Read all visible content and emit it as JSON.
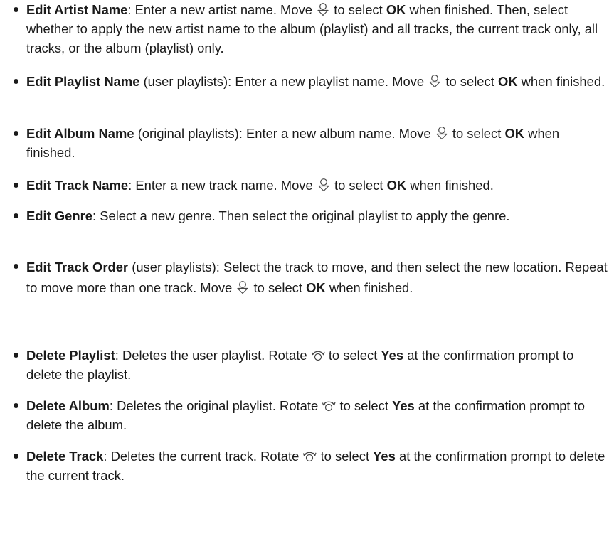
{
  "items": [
    {
      "term": "Edit Artist Name",
      "qualifier": "",
      "p1": ": Enter a new artist name. Move ",
      "icon1": "joystick-down-icon",
      "p2": " to select ",
      "kw1": "OK",
      "p3": " when finished. Then, select whether to apply the new artist name to the album (playlist) and all tracks, the current track only, all tracks, or the album (playlist) only."
    },
    {
      "term": "Edit Playlist Name",
      "qualifier": " (user playlists)",
      "p1": ": Enter a new playlist name. Move ",
      "icon1": "joystick-down-icon",
      "p2": " to select ",
      "kw1": "OK",
      "p3": " when finished."
    },
    {
      "term": "Edit Album Name",
      "qualifier": " (original playlists)",
      "p1": ": Enter a new album name. Move ",
      "icon1": "joystick-down-icon",
      "p2": " to select ",
      "kw1": "OK",
      "p3": " when finished."
    },
    {
      "term": "Edit Track Name",
      "qualifier": "",
      "p1": ": Enter a new track name. Move ",
      "icon1": "joystick-down-icon",
      "p2": " to select ",
      "kw1": "OK",
      "p3": " when finished."
    },
    {
      "term": "Edit Genre",
      "qualifier": "",
      "p1": ": Select a new genre. Then select the original playlist to apply the genre."
    },
    {
      "term": "Edit Track Order",
      "qualifier": " (user playlists)",
      "p1": ": Select the track to move, and then select the new location. Repeat to move more than one track. Move ",
      "icon1": "joystick-down-icon",
      "p2": " to select ",
      "kw1": "OK",
      "p3": " when finished."
    },
    {
      "term": "Delete Playlist",
      "qualifier": "",
      "p1": ": Deletes the user playlist. Rotate ",
      "icon1": "rotate-dial-icon",
      "p2": " to select ",
      "kw1": "Yes",
      "p3": " at the confirmation prompt to delete the playlist."
    },
    {
      "term": "Delete Album",
      "qualifier": "",
      "p1": ": Deletes the original playlist. Rotate ",
      "icon1": "rotate-dial-icon",
      "p2": " to select ",
      "kw1": "Yes",
      "p3": " at the confirmation prompt to delete the album."
    },
    {
      "term": "Delete Track",
      "qualifier": "",
      "p1": ": Deletes the current track. Rotate ",
      "icon1": "rotate-dial-icon",
      "p2": " to select ",
      "kw1": "Yes",
      "p3": " at the confirmation prompt to delete the current track."
    }
  ]
}
